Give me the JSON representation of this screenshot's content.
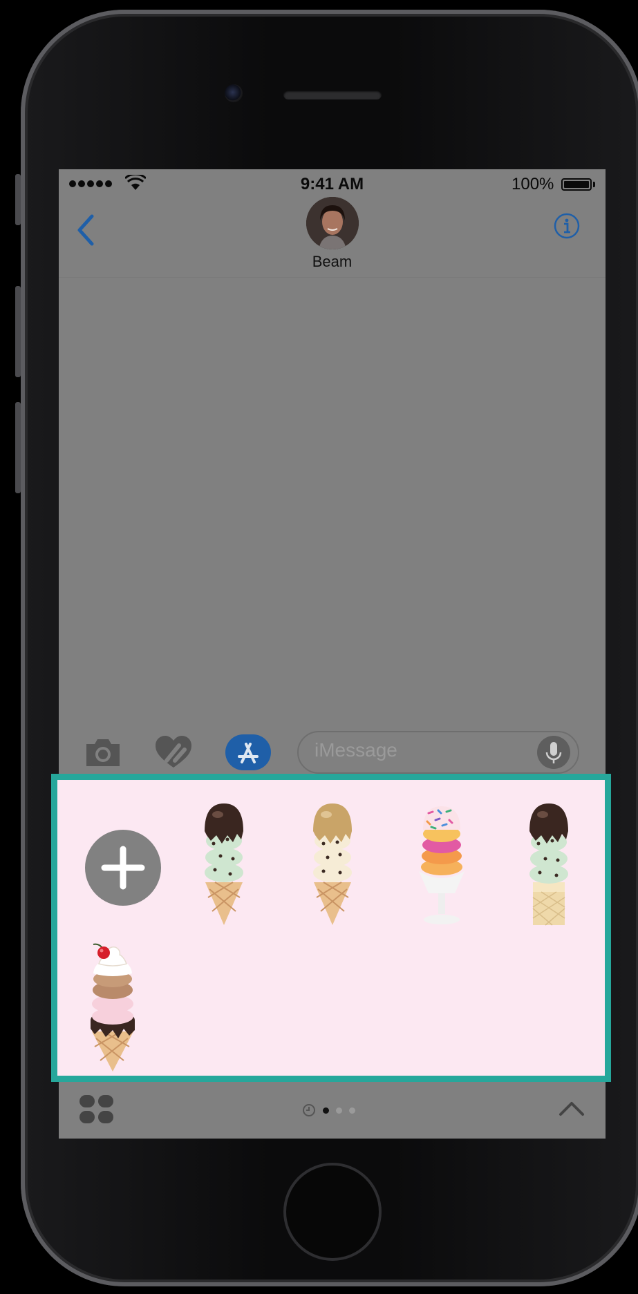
{
  "status_bar": {
    "time": "9:41 AM",
    "battery_percent": "100%",
    "signal_bars": 5,
    "battery_level": 1.0
  },
  "nav": {
    "contact_name": "Beam",
    "back_icon": "chevron-left-icon",
    "info_icon": "info-circle-icon"
  },
  "input_bar": {
    "placeholder": "iMessage",
    "tools": [
      "camera-icon",
      "digital-touch-heart-icon",
      "app-store-icon"
    ],
    "mic_icon": "microphone-icon"
  },
  "sticker_drawer": {
    "add_icon": "plus-icon",
    "stickers": [
      {
        "name": "mint-chip-chocolate-dip-cone"
      },
      {
        "name": "cookie-dough-caramel-cone"
      },
      {
        "name": "sprinkle-sherbet-sundae"
      },
      {
        "name": "mint-chip-chocolate-cup-cone"
      },
      {
        "name": "cherry-triple-scoop-cone"
      }
    ]
  },
  "app_bar": {
    "apps_icon": "app-drawer-grid-icon",
    "recents_icon": "clock-icon",
    "page_count": 3,
    "active_page": 1,
    "expand_icon": "chevron-up-icon"
  },
  "colors": {
    "drawer_border": "#26a79b",
    "drawer_background": "#fce8f2",
    "ios_blue": "#1f5fa8",
    "dimmed_screen": "#808080"
  }
}
